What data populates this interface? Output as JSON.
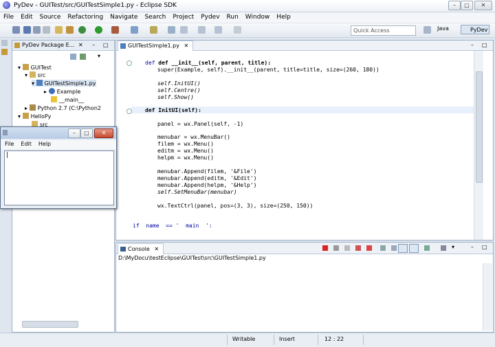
{
  "window": {
    "title": "PyDev - GUITest/src/GUITestSimple1.py - Eclipse SDK",
    "icon": "eclipse-icon"
  },
  "menu": [
    "File",
    "Edit",
    "Source",
    "Refactoring",
    "Navigate",
    "Search",
    "Project",
    "Pydev",
    "Run",
    "Window",
    "Help"
  ],
  "toolbar": {
    "quick_access_placeholder": "Quick Access",
    "perspective_java": "Java",
    "perspective_pydev": "PyDev"
  },
  "package_explorer": {
    "title": "PyDev Package E...",
    "tree": [
      {
        "label": "GUITest",
        "icon": "project-icon"
      },
      {
        "label": "src",
        "icon": "source-folder-icon"
      },
      {
        "label": "GUITestSimple1.py",
        "icon": "python-file-icon"
      },
      {
        "label": "Example",
        "icon": "class-icon"
      },
      {
        "label": "__main__",
        "icon": "main-icon"
      },
      {
        "label": "Python 2.7  (C:\\Python2",
        "icon": "python-interpreter-icon"
      },
      {
        "label": "HelloPy",
        "icon": "project-icon"
      },
      {
        "label": "src",
        "icon": "source-folder-icon"
      }
    ]
  },
  "editor": {
    "tab_label": "GUITestSimple1.py",
    "lines": [
      "def __init__(self, parent, title):",
      "super(Example, self).__init__(parent, title=title, size=(260, 180))",
      "self.InitUI()",
      "self.Centre()",
      "self.Show()",
      "def InitUI(self):",
      "panel = wx.Panel(self, -1)",
      "menubar = wx.MenuBar()",
      "filem = wx.Menu()",
      "editm = wx.Menu()",
      "helpm = wx.Menu()",
      "menubar.Append(filem, '&File')",
      "menubar.Append(editm, '&Edit')",
      "menubar.Append(helpm, '&Help')",
      "self.SetMenuBar(menubar)",
      "wx.TextCtrl(panel, pos=(3, 3), size=(250, 150))",
      "if  name  == '  main  ':"
    ]
  },
  "console": {
    "tab_label": "Console",
    "path": "D:\\MyDocu\\testEclipse\\GUITest\\src\\GUITestSimple1.py"
  },
  "status": {
    "writable": "Writable",
    "insert": "Insert",
    "position": "12 : 22"
  },
  "float_window": {
    "menu": [
      "File",
      "Edit",
      "Help"
    ],
    "text_value": "|"
  }
}
